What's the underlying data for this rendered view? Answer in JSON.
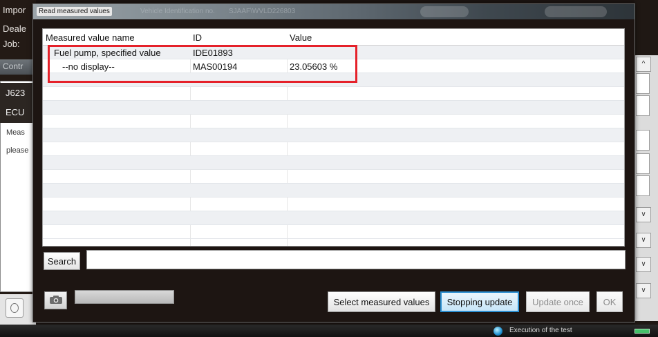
{
  "background": {
    "left_labels": [
      "Impor",
      "Deale",
      "Job:"
    ],
    "control_bar_label": "Contr",
    "ecu_rows": [
      "J623",
      "ECU"
    ],
    "panel_texts": [
      "Meas",
      "please"
    ]
  },
  "dialog": {
    "title": "Read measured values",
    "title_ghost_1": "Vehicle Identification no.",
    "title_ghost_2": "SJAAF\\WVLD226803"
  },
  "table": {
    "columns": [
      "Measured value name",
      "ID",
      "Value"
    ],
    "rows": [
      {
        "name": "Fuel pump, specified value",
        "id": "IDE01893",
        "value": ""
      },
      {
        "name": "--no display--",
        "id": "MAS00194",
        "value": "23.05603 %"
      }
    ]
  },
  "search": {
    "label": "Search",
    "value": ""
  },
  "footer": {
    "buttons": {
      "select": "Select measured values",
      "stopping": "Stopping update",
      "update_once": "Update once",
      "ok": "OK"
    }
  },
  "statusbar": {
    "text": "Execution of the test"
  },
  "icons": {
    "camera": "camera-icon",
    "status": "globe-icon",
    "doc": "document-search-icon"
  },
  "colors": {
    "highlight": "#e5212a",
    "active_border": "#2c8fd1"
  }
}
